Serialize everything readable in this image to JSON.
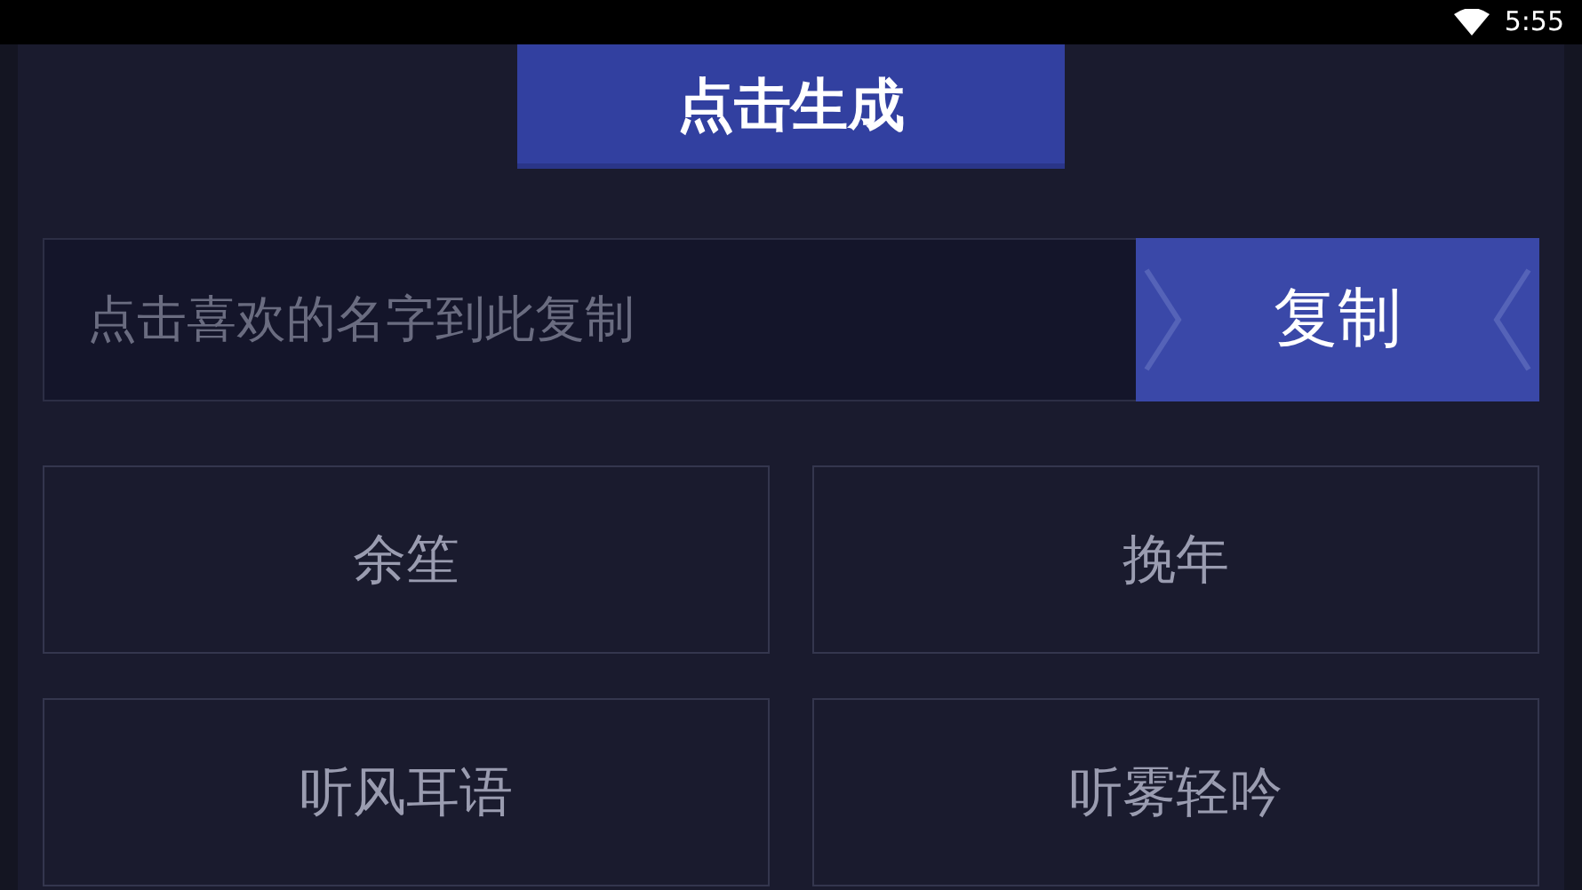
{
  "status_bar": {
    "time": "5:55"
  },
  "generate_button": {
    "label": "点击生成"
  },
  "copy_row": {
    "placeholder": "点击喜欢的名字到此复制",
    "button": "复制"
  },
  "names": [
    {
      "label": "余笙"
    },
    {
      "label": "挽年"
    },
    {
      "label": "听风耳语"
    },
    {
      "label": "听雾轻吟"
    }
  ]
}
